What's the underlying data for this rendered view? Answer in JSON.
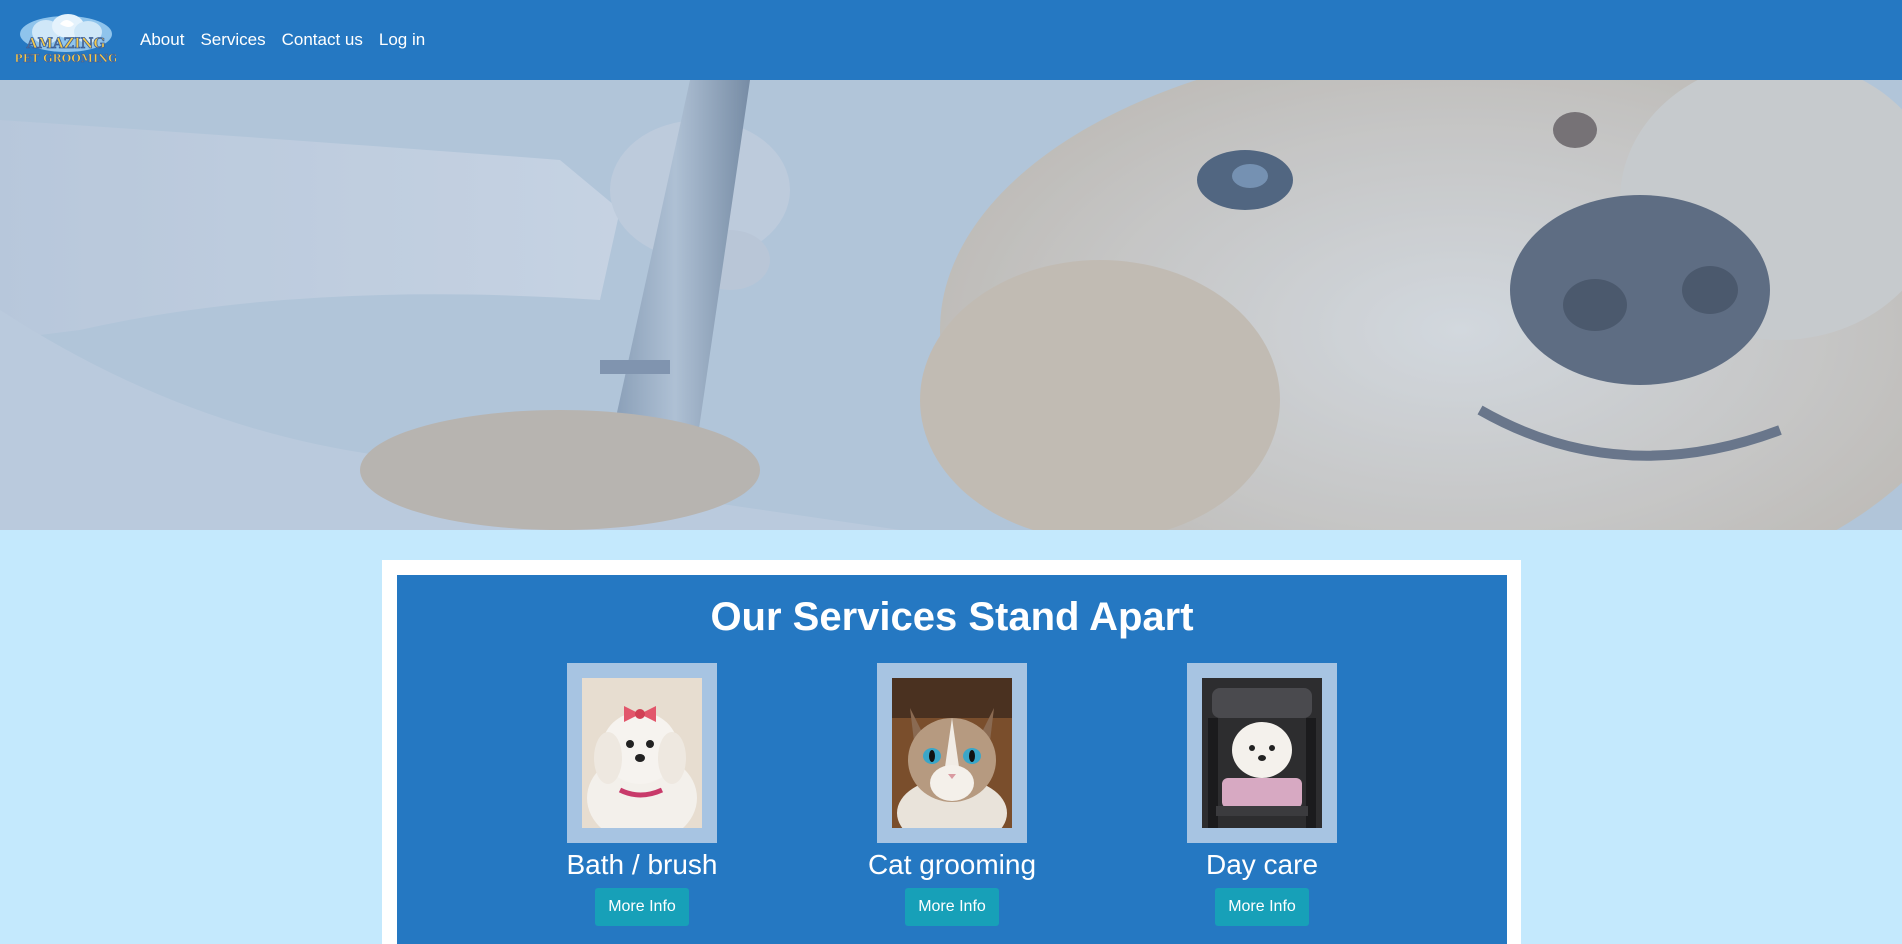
{
  "logo": {
    "line1": "AMAZING",
    "line2": "PET GROOMING"
  },
  "nav": {
    "items": [
      {
        "label": "About"
      },
      {
        "label": "Services"
      },
      {
        "label": "Contact us"
      },
      {
        "label": "Log in"
      }
    ]
  },
  "colors": {
    "header": "#2578c2",
    "page_background": "#c4e9fd",
    "button": "#17a0b8",
    "frame": "#a7c4e2"
  },
  "services": {
    "title": "Our Services Stand Apart",
    "items": [
      {
        "name": "Bath / brush",
        "button": "More Info",
        "photo": "white-dog-with-bow"
      },
      {
        "name": "Cat grooming",
        "button": "More Info",
        "photo": "tabby-cat"
      },
      {
        "name": "Day care",
        "button": "More Info",
        "photo": "dog-in-stroller"
      }
    ]
  }
}
